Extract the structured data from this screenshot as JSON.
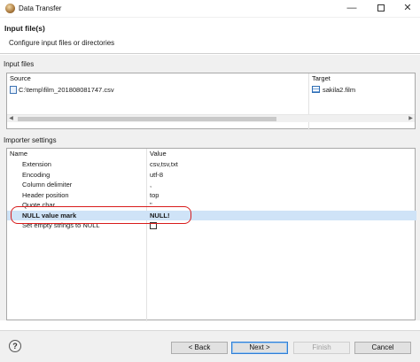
{
  "window": {
    "title": "Data Transfer",
    "minimize": "—",
    "close": "✕"
  },
  "header": {
    "title": "Input file(s)",
    "subtitle": "Configure input files or directories"
  },
  "input_files": {
    "label": "Input files",
    "columns": [
      "Source",
      "Target"
    ],
    "rows": [
      {
        "source": "C:\\temp\\film_201808081747.csv",
        "target": "sakila2.film"
      }
    ]
  },
  "importer": {
    "label": "Importer settings",
    "columns": [
      "Name",
      "Value"
    ],
    "rows": [
      {
        "name": "Extension",
        "value": "csv,tsv,txt"
      },
      {
        "name": "Encoding",
        "value": "utf-8"
      },
      {
        "name": "Column delimiter",
        "value": ","
      },
      {
        "name": "Header position",
        "value": "top"
      },
      {
        "name": "Quote char",
        "value": "\""
      },
      {
        "name": "NULL value mark",
        "value": "NULL!",
        "selected": true
      },
      {
        "name": "Set empty strings to NULL",
        "value": "",
        "checkbox": true,
        "checked": false
      }
    ]
  },
  "highlight_color": "#d81b1b",
  "selection_color": "#cfe3f7",
  "footer": {
    "help": "?",
    "back": "< Back",
    "next": "Next >",
    "finish": "Finish",
    "cancel": "Cancel"
  }
}
